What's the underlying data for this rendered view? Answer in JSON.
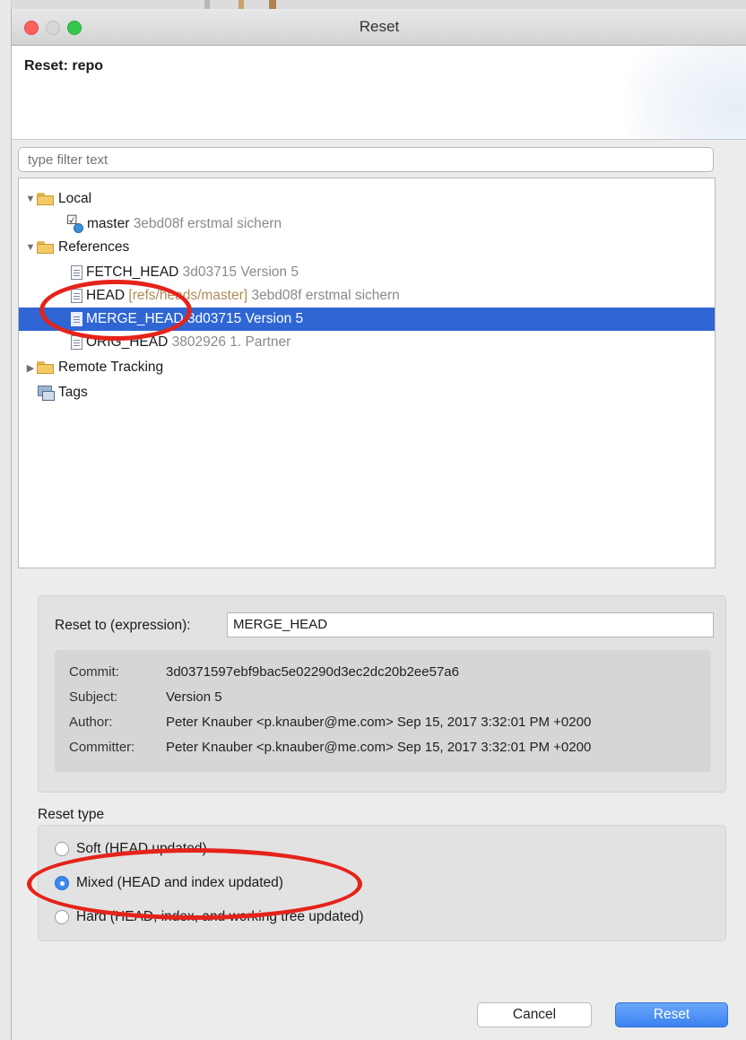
{
  "window": {
    "title": "Reset"
  },
  "header": {
    "title": "Reset: repo"
  },
  "filter": {
    "placeholder": "type filter text"
  },
  "tree": {
    "local": {
      "label": "Local",
      "master": {
        "name": "master",
        "detail": "3ebd08f erstmal sichern"
      }
    },
    "references": {
      "label": "References",
      "fetch_head": {
        "name": "FETCH_HEAD",
        "detail": "3d03715 Version 5"
      },
      "head": {
        "name": "HEAD",
        "ref": "[refs/heads/master]",
        "detail": "3ebd08f erstmal sichern"
      },
      "merge_head": {
        "name": "MERGE_HEAD",
        "detail": "3d03715 Version 5"
      },
      "orig_head": {
        "name": "ORIG_HEAD",
        "detail": "3802926 1. Partner"
      }
    },
    "remote_tracking": {
      "label": "Remote Tracking"
    },
    "tags": {
      "label": "Tags"
    }
  },
  "expression": {
    "label": "Reset to (expression):",
    "value": "MERGE_HEAD"
  },
  "commit_info": {
    "commit_label": "Commit:",
    "commit": "3d0371597ebf9bac5e02290d3ec2dc20b2ee57a6",
    "subject_label": "Subject:",
    "subject": "Version 5",
    "author_label": "Author:",
    "author": "Peter Knauber <p.knauber@me.com> Sep 15, 2017 3:32:01 PM +0200",
    "committer_label": "Committer:",
    "committer": "Peter Knauber <p.knauber@me.com> Sep 15, 2017 3:32:01 PM +0200"
  },
  "reset_type": {
    "label": "Reset type",
    "soft": "Soft (HEAD updated)",
    "mixed": "Mixed (HEAD and index updated)",
    "hard": "Hard (HEAD, index, and working tree updated)",
    "selected": "mixed"
  },
  "buttons": {
    "cancel": "Cancel",
    "reset": "Reset"
  },
  "colors": {
    "selection": "#2f66d4",
    "annotation": "#e5231a",
    "primary_button": "#3b82f0"
  }
}
